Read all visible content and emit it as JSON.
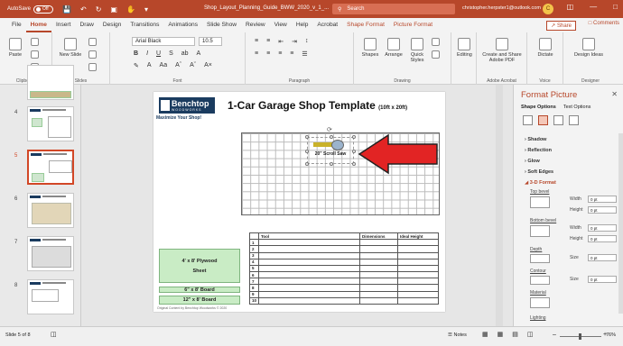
{
  "titlebar": {
    "autosave": "AutoSave",
    "autosave_state": "Off",
    "doc_title": "Shop_Layout_Planning_Guide_BWW_2020_v_1_...",
    "search_placeholder": "Search",
    "user_email": "christopher.herpster1@outlook.com",
    "avatar_initial": "C"
  },
  "tabs": [
    "File",
    "Home",
    "Insert",
    "Draw",
    "Design",
    "Transitions",
    "Animations",
    "Slide Show",
    "Review",
    "View",
    "Help",
    "Acrobat",
    "Shape Format",
    "Picture Format"
  ],
  "active_tab": "Home",
  "share_label": "Share",
  "comments_label": "Comments",
  "ribbon": {
    "clipboard": {
      "paste": "Paste",
      "label": "Clipboard"
    },
    "slides": {
      "new_slide": "New Slide",
      "label": "Slides"
    },
    "font": {
      "name": "Arial Black",
      "size": "10.5",
      "label": "Font"
    },
    "paragraph": {
      "label": "Paragraph"
    },
    "drawing": {
      "shapes": "Shapes",
      "arrange": "Arrange",
      "quick_styles": "Quick Styles",
      "label": "Drawing"
    },
    "editing": {
      "label": "Editing"
    },
    "acrobat": {
      "create_share": "Create and Share Adobe PDF",
      "label": "Adobe Acrobat"
    },
    "voice": {
      "dictate": "Dictate",
      "label": "Voice"
    },
    "designer": {
      "design_ideas": "Design Ideas",
      "label": "Designer"
    }
  },
  "thumbnails": [
    {
      "num": "4"
    },
    {
      "num": "5"
    },
    {
      "num": "6"
    },
    {
      "num": "7"
    },
    {
      "num": "8"
    }
  ],
  "selected_slide": "5",
  "slide": {
    "logo_name": "Benchtop",
    "logo_sub": "WOODWORKS",
    "tagline": "Maximize Your Shop!",
    "title": "1-Car Garage Shop Template",
    "title_dims": "(10ft x 20ft)",
    "saw_label": "20\" Scroll Saw",
    "plywood": "4' x 8' Plywood Sheet",
    "board1": "6\" x 8' Board",
    "board2": "12\" x 8' Board",
    "copyright": "Original Content by Benchtop Woodworks © 2020",
    "table_headers": [
      "",
      "Tool",
      "Dimensions",
      "Ideal Height"
    ],
    "table_rows": [
      "1",
      "2",
      "3",
      "4",
      "5",
      "6",
      "7",
      "8",
      "9",
      "10"
    ]
  },
  "format_panel": {
    "title": "Format Picture",
    "tabs": [
      "Shape Options",
      "Text Options"
    ],
    "sections": [
      "Shadow",
      "Reflection",
      "Glow",
      "Soft Edges",
      "3-D Format"
    ],
    "top_bevel": "Top bevel",
    "bottom_bevel": "Bottom bevel",
    "width_label": "Width",
    "height_label": "Height",
    "width_val": "0 pt",
    "height_val": "0 pt",
    "width2_val": "0 pt",
    "height2_val": "0 pt",
    "depth": "Depth",
    "depth_size": "Size",
    "depth_val": "0 pt",
    "contour": "Contour",
    "contour_size": "Size",
    "contour_val": "0 pt",
    "material": "Material",
    "lighting": "Lighting"
  },
  "statusbar": {
    "slide_info": "Slide 5 of 8",
    "notes": "Notes",
    "zoom": "76%"
  },
  "colors": {
    "accent": "#b7472a",
    "arrow": "#e22424"
  }
}
